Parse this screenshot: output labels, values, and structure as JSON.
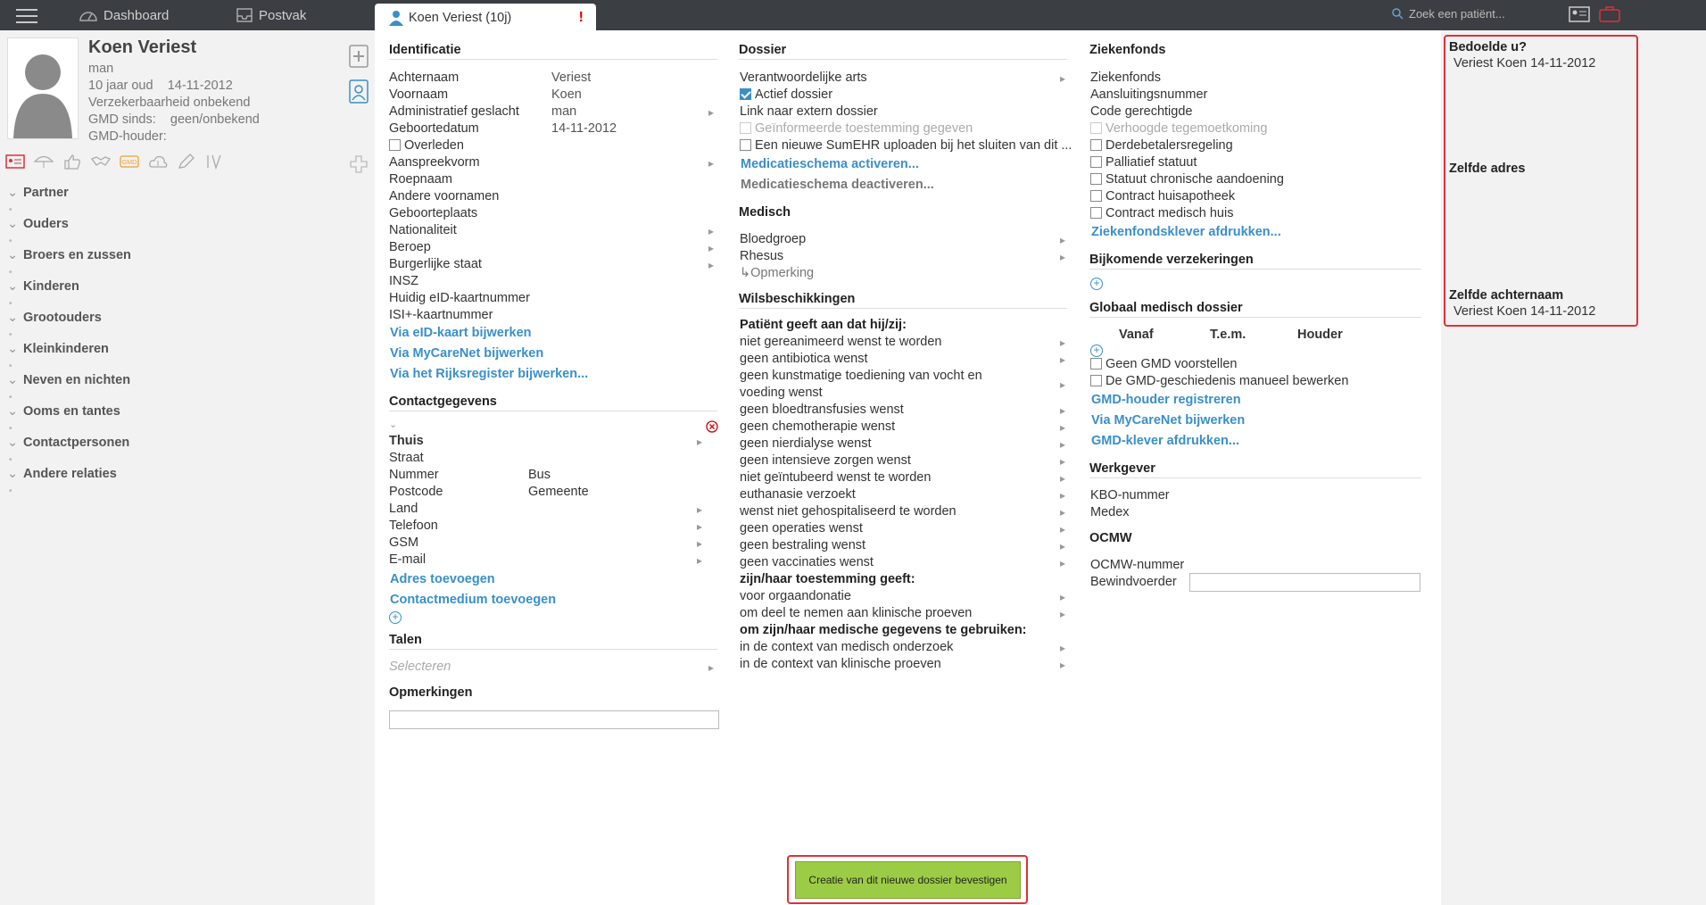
{
  "nav": {
    "dashboard": "Dashboard",
    "postvak": "Postvak",
    "search_placeholder": "Zoek een patiënt..."
  },
  "tab": {
    "label": "Koen Veriest (10j)",
    "alert": "!"
  },
  "patient": {
    "name": "Koen Veriest",
    "sex": "man",
    "age": "10 jaar oud",
    "dob": "14-11-2012",
    "insurability": "Verzekerbaarheid onbekend",
    "gmd_since_label": "GMD sinds:",
    "gmd_since_value": "geen/onbekend",
    "gmd_holder_label": "GMD-houder:"
  },
  "relations": [
    "Partner",
    "Ouders",
    "Broers en zussen",
    "Kinderen",
    "Grootouders",
    "Kleinkinderen",
    "Neven en nichten",
    "Ooms en tantes",
    "Contactpersonen",
    "Andere relaties"
  ],
  "identificatie": {
    "title": "Identificatie",
    "rows": [
      {
        "label": "Achternaam",
        "value": "Veriest"
      },
      {
        "label": "Voornaam",
        "value": "Koen"
      },
      {
        "label": "Administratief geslacht",
        "value": "man"
      },
      {
        "label": "Geboortedatum",
        "value": "14-11-2012"
      },
      {
        "label": "Overleden",
        "value": ""
      },
      {
        "label": "Aanspreekvorm",
        "value": ""
      },
      {
        "label": "Roepnaam",
        "value": ""
      },
      {
        "label": "Andere voornamen",
        "value": ""
      },
      {
        "label": "Geboorteplaats",
        "value": ""
      },
      {
        "label": "Nationaliteit",
        "value": ""
      },
      {
        "label": "Beroep",
        "value": ""
      },
      {
        "label": "Burgerlijke staat",
        "value": ""
      },
      {
        "label": "INSZ",
        "value": ""
      },
      {
        "label": "Huidig eID-kaartnummer",
        "value": ""
      },
      {
        "label": "ISI+-kaartnummer",
        "value": ""
      }
    ],
    "links": [
      "Via eID-kaart bijwerken",
      "Via MyCareNet bijwerken",
      "Via het Rijksregister bijwerken..."
    ]
  },
  "contact": {
    "title": "Contactgegevens",
    "thuis": "Thuis",
    "straat": "Straat",
    "nummer": "Nummer",
    "bus": "Bus",
    "postcode": "Postcode",
    "gemeente": "Gemeente",
    "land": "Land",
    "telefoon": "Telefoon",
    "gsm": "GSM",
    "email": "E-mail",
    "links": [
      "Adres toevoegen",
      "Contactmedium toevoegen"
    ]
  },
  "talen": {
    "title": "Talen",
    "placeholder": "Selecteren"
  },
  "opmerkingen": {
    "title": "Opmerkingen"
  },
  "dossier": {
    "title": "Dossier",
    "arts": "Verantwoordelijke arts",
    "actief": "Actief dossier",
    "extern": "Link naar extern dossier",
    "toestemming": "Geïnformeerde toestemming gegeven",
    "sumehr": "Een nieuwe SumEHR uploaden bij het sluiten van dit ...",
    "act": "Medicatieschema activeren...",
    "deact": "Medicatieschema deactiveren..."
  },
  "medisch": {
    "title": "Medisch",
    "bloedgroep": "Bloedgroep",
    "rhesus": "Rhesus",
    "opmerking": "Opmerking"
  },
  "wils": {
    "title": "Wilsbeschikkingen",
    "h1": "Patiënt geeft aan dat hij/zij:",
    "items1": [
      "niet gereanimeerd wenst te worden",
      "geen antibiotica wenst",
      "geen kunstmatige toediening van vocht en",
      "voeding wenst",
      "geen bloedtransfusies wenst",
      "geen chemotherapie wenst",
      "geen nierdialyse wenst",
      "geen intensieve zorgen wenst",
      "niet geïntubeerd wenst te worden",
      "euthanasie verzoekt",
      "wenst niet gehospitaliseerd te worden",
      "geen operaties wenst",
      "geen bestraling wenst",
      "geen vaccinaties wenst"
    ],
    "h2": "zijn/haar toestemming geeft:",
    "items2": [
      "voor orgaandonatie",
      "om deel te nemen aan klinische proeven"
    ],
    "h3": "om zijn/haar medische gegevens te gebruiken:",
    "items3": [
      "in de context van medisch onderzoek",
      "in de context van klinische proeven"
    ]
  },
  "ziekenfonds": {
    "title": "Ziekenfonds",
    "ziekenfonds": "Ziekenfonds",
    "aansluiting": "Aansluitingsnummer",
    "code": "Code gerechtigde",
    "verhoogde": "Verhoogde tegemoetkoming",
    "derde": "Derdebetalersregeling",
    "palliatief": "Palliatief statuut",
    "chronisch": "Statuut chronische aandoening",
    "huisapotheek": "Contract huisapotheek",
    "medischhuis": "Contract medisch huis",
    "klever": "Ziekenfondsklever afdrukken..."
  },
  "bijkomende": {
    "title": "Bijkomende verzekeringen"
  },
  "gmd": {
    "title": "Globaal medisch dossier",
    "vanaf": "Vanaf",
    "tem": "T.e.m.",
    "houder": "Houder",
    "geen": "Geen GMD voorstellen",
    "manueel": "De GMD-geschiedenis manueel bewerken",
    "links": [
      "GMD-houder registreren",
      "Via MyCareNet bijwerken",
      "GMD-klever afdrukken..."
    ]
  },
  "werkgever": {
    "title": "Werkgever",
    "kbo": "KBO-nummer",
    "medex": "Medex"
  },
  "ocmw": {
    "title": "OCMW",
    "nummer": "OCMW-nummer",
    "bewind": "Bewindvoerder"
  },
  "suggestions": {
    "bedoelde": "Bedoelde u?",
    "bedoelde_val": "Veriest Koen 14-11-2012",
    "adres": "Zelfde adres",
    "achternaam": "Zelfde achternaam",
    "achternaam_val": "Veriest Koen 14-11-2012"
  },
  "confirm": "Creatie van dit nieuwe dossier bevestigen",
  "colors": {
    "accent": "#3a8fc8",
    "alert": "#e0303a",
    "confirm": "#9ccc45",
    "topbar": "#3b3e42"
  }
}
